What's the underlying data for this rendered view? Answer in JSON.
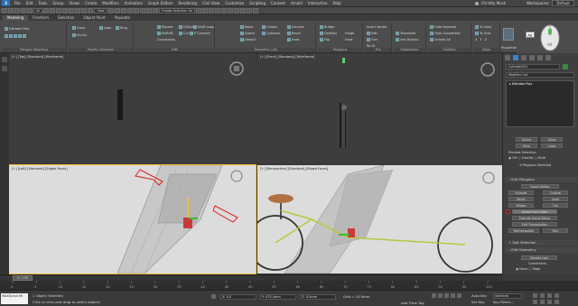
{
  "menubar": {
    "items": [
      "File",
      "Edit",
      "Tools",
      "Group",
      "Views",
      "Create",
      "Modifiers",
      "Animation",
      "Graph Editors",
      "Rendering",
      "Civil View",
      "Customize",
      "Scripting",
      "Content",
      "Arnold",
      "Interactive",
      "Help"
    ],
    "user": "Christty Musk",
    "workspaces_label": "Workspaces:",
    "workspace_value": "Default"
  },
  "toolbar": {
    "selection_set": "Create Selection Se"
  },
  "ribbon_tabs": [
    "Modeling",
    "Freeform",
    "Selection",
    "Object Paint",
    "Populate"
  ],
  "ribbon": {
    "left_labels": [
      "Polygon Modeling",
      "Modify Selection"
    ],
    "editable_poly": "Editable Poly",
    "modify_selection": [
      "Grow",
      "Shrink",
      "Loop",
      "Ring"
    ],
    "edit": [
      "Repeat",
      "QSlice",
      "Swift Loop",
      "NURMS",
      "Cut",
      "P Connect",
      "Constraints"
    ],
    "geometry": [
      "Relax",
      "Attach",
      "Detach",
      "Create",
      "Collapse",
      "Extrude",
      "Bevel",
      "Inset",
      "Bridge",
      "GeoPoly",
      "Flip"
    ],
    "polygons_labels": [
      "Hinge",
      "Inset"
    ],
    "tris": [
      "Insert Vertex",
      "Edit",
      "Turn",
      "Re-Tri"
    ],
    "subdivision": [
      "Tessellate",
      "Use Displac."
    ],
    "visibility": [
      "Hide Selected",
      "Hide Unselected",
      "Unhide All"
    ],
    "align": [
      "To View",
      "To Grid",
      "X",
      "Y",
      "Z"
    ],
    "group_labels": [
      "Edit",
      "Geometry (All)",
      "Polygons",
      "Tris",
      "Subdivision",
      "Visibility",
      "Align",
      "Properties"
    ]
  },
  "viewports": {
    "top": "[+] [Top] [Standard] [Wireframe]",
    "front": "[+] [Front] [Standard] [Wireframe]",
    "left": "[+] [Left] [Standard] [Edged Faces]",
    "perspective": "[+] [Perspective] [Standard] [Edged Faces]"
  },
  "command_panel": {
    "object_name": "Cylinder001",
    "modifier_list": "Modifier List",
    "stack_item": "Editable Poly",
    "selection_buttons": [
      "Shrink",
      "Grow",
      "Ring",
      "Loop"
    ],
    "preview_selection": "Preview Selection",
    "preview_options": [
      "Off",
      "SubObj",
      "Multi"
    ],
    "status_selected": "4 Polygons Selected",
    "edit_polygons": "Edit Polygons",
    "insert_vertex": "Insert Vertex",
    "ep_buttons": [
      "Extrude",
      "Outline",
      "Bevel",
      "Inset",
      "Bridge",
      "Flip"
    ],
    "hinge": "Hinge From Edge",
    "extrude_spline": "Extrude Along Spline",
    "edit_triangulation": "Edit Triangulation",
    "retriangulate": "Retriangulate",
    "turn": "Turn",
    "soft_selection": "Soft Selection",
    "edit_geometry": "Edit Geometry",
    "repeat_last": "Repeat Last",
    "constraints": "Constraints",
    "constraint_opts": [
      "None",
      "Edge"
    ]
  },
  "timeline": {
    "frame": "0 / 100",
    "ticks": [
      "0",
      "5",
      "10",
      "15",
      "20",
      "25",
      "30",
      "35",
      "40",
      "45",
      "50",
      "55",
      "60",
      "65",
      "70",
      "75",
      "80",
      "85",
      "90",
      "95",
      "100"
    ]
  },
  "status": {
    "maxscript": "MAXScript Mi",
    "selected": "1 Object Selected",
    "prompt": "Click or click-and-drag to select objects",
    "x": "X: 0.0",
    "y": "Y: 475.4mm",
    "z": "Z: 0.0mm",
    "grid": "Grid = 10.0mm",
    "add_time_tag": "Add Time Tag",
    "auto_key": "Auto Key",
    "set_key": "Set Key",
    "selected_dd": "Selected",
    "key_filters": "Key Filters..."
  },
  "colors": {
    "accent": "#f0c030",
    "arrow_red": "#e02020",
    "seat": "#b07040",
    "frame_green": "#b8c840"
  }
}
